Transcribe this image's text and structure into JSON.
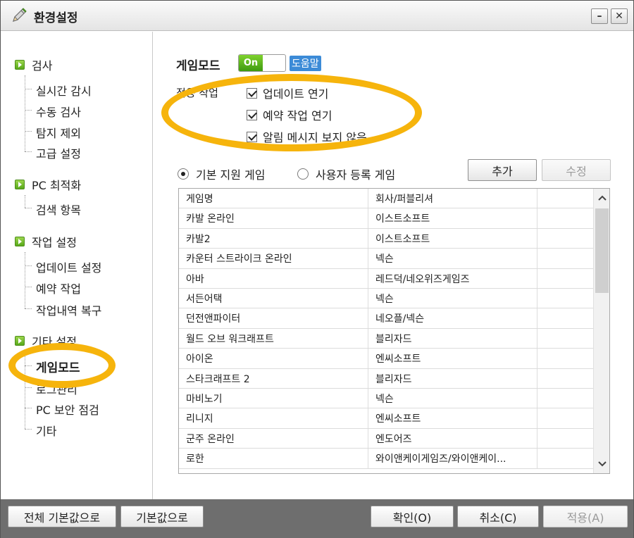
{
  "window": {
    "title": "환경설정",
    "minimize": "–",
    "close": "✕"
  },
  "sidebar": {
    "groups": [
      {
        "label": "검사",
        "items": [
          "실시간 감시",
          "수동 검사",
          "탐지 제외",
          "고급 설정"
        ]
      },
      {
        "label": "PC 최적화",
        "items": [
          "검색 항목"
        ]
      },
      {
        "label": "작업 설정",
        "items": [
          "업데이트 설정",
          "예약 작업",
          "작업내역 복구"
        ]
      },
      {
        "label": "기타 설정",
        "items": [
          "게임모드",
          "로그관리",
          "PC 보안 점검",
          "기타"
        ]
      }
    ],
    "selected": "게임모드"
  },
  "main": {
    "title": "게임모드",
    "toggle_on": "On",
    "help": "도움말",
    "apply_label": "적용 작업",
    "checks": [
      "업데이트 연기",
      "예약 작업 연기",
      "알림 메시지 보지 않음"
    ],
    "radio_default": "기본 지원 게임",
    "radio_user": "사용자 등록 게임",
    "add_button": "추가",
    "edit_button": "수정",
    "table": {
      "headers": [
        "게임명",
        "회사/퍼블리셔"
      ],
      "rows": [
        [
          "카발 온라인",
          "이스트소프트"
        ],
        [
          "카발2",
          "이스트소프트"
        ],
        [
          "카운터 스트라이크 온라인",
          "넥슨"
        ],
        [
          "아바",
          "레드덕/네오위즈게임즈"
        ],
        [
          "서든어택",
          "넥슨"
        ],
        [
          "던전앤파이터",
          "네오플/넥슨"
        ],
        [
          "월드 오브 워크래프트",
          "블리자드"
        ],
        [
          "아이온",
          "엔씨소프트"
        ],
        [
          "스타크래프트 2",
          "블리자드"
        ],
        [
          "마비노기",
          "넥슨"
        ],
        [
          "리니지",
          "엔씨소프트"
        ],
        [
          "군주 온라인",
          "엔도어즈"
        ],
        [
          "로한",
          "와이앤케이게임즈/와이앤케이..."
        ]
      ]
    }
  },
  "bottom": {
    "reset_all": "전체 기본값으로",
    "reset": "기본값으로",
    "ok": "확인(O)",
    "cancel": "취소(C)",
    "apply": "적용(A)"
  }
}
